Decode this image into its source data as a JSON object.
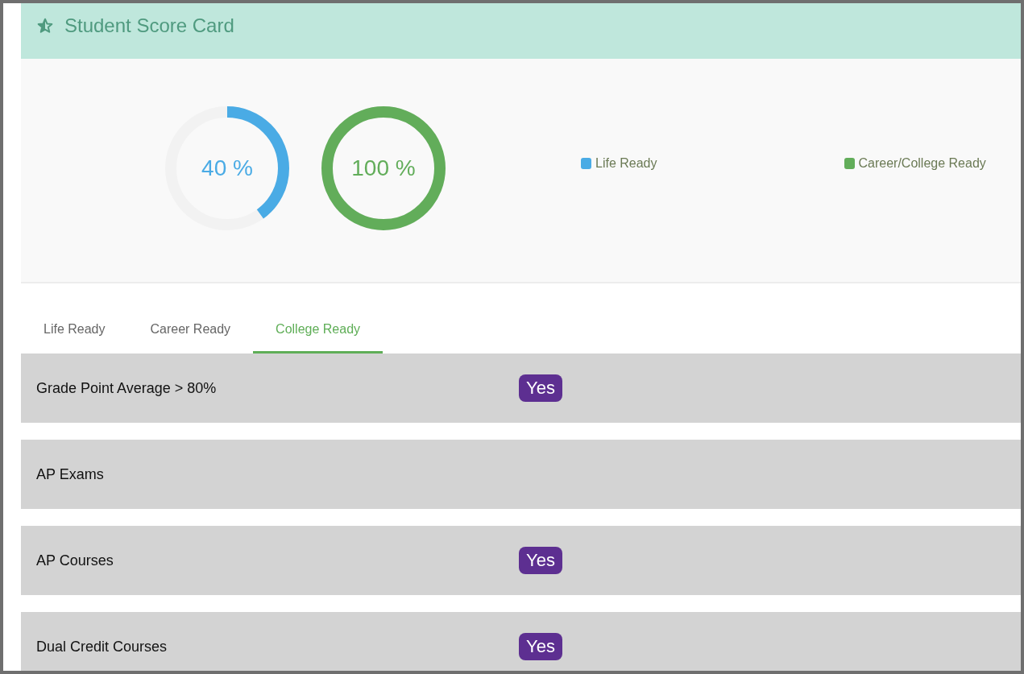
{
  "header": {
    "title": "Student Score Card"
  },
  "gauges": [
    {
      "value": "40 %",
      "level": 0.4,
      "color": "#4aabe5"
    },
    {
      "value": "100 %",
      "level": 1,
      "color": "#62ad5a"
    }
  ],
  "legend": [
    {
      "label": "Life Ready",
      "color": "#4aabe5"
    },
    {
      "label": "Career/College Ready",
      "color": "#62ad5a"
    }
  ],
  "tabs": [
    {
      "label": "Life Ready",
      "selected": false
    },
    {
      "label": "Career Ready",
      "selected": false
    },
    {
      "label": "College Ready",
      "selected": true
    }
  ],
  "rows": [
    {
      "label": "Grade Point Average > 80%",
      "badge": "Yes"
    },
    {
      "label": "AP Exams"
    },
    {
      "label": "AP Courses",
      "badge": "Yes"
    },
    {
      "label": "Dual Credit Courses",
      "badge": "Yes"
    }
  ]
}
